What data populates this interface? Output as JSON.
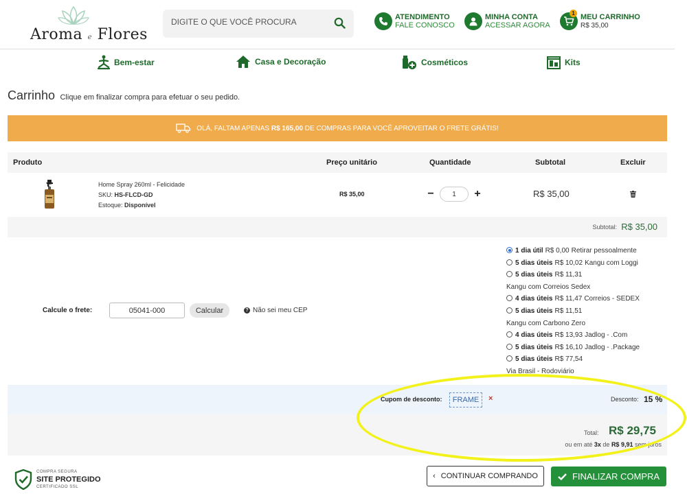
{
  "header": {
    "logo_text": "Aroma",
    "logo_amp": "e",
    "logo_text2": "Flores",
    "search_placeholder": "DIGITE O QUE VOCÊ PROCURA",
    "support_title": "ATENDIMENTO",
    "support_sub": "FALE CONOSCO",
    "account_title": "MINHA CONTA",
    "account_sub": "ACESSAR AGORA",
    "cart_title": "MEU CARRINHO",
    "cart_total": "R$ 35,00",
    "cart_count": "1"
  },
  "nav": [
    {
      "label": "Bem-estar",
      "icon": "yoga-icon"
    },
    {
      "label": "Casa e Decoração",
      "icon": "house-icon"
    },
    {
      "label": "Cosméticos",
      "icon": "cosmetics-icon"
    },
    {
      "label": "Kits",
      "icon": "kits-icon"
    }
  ],
  "page": {
    "title": "Carrinho",
    "subtitle": "Clique em finalizar compra para efetuar o seu pedido."
  },
  "banner": {
    "pre": "OLÁ, FALTAM APENAS",
    "amount": "R$ 165,00",
    "post": "DE COMPRAS PARA VOCÊ APROVEITAR O FRETE GRÁTIS!"
  },
  "table": {
    "headers": [
      "Produto",
      "Preço unitário",
      "Quantidade",
      "Subtotal",
      "Excluir"
    ],
    "item": {
      "name": "Home Spray 260ml - Felicidade",
      "sku_label": "SKU:",
      "sku": "HS-FLCD-GD",
      "stock_label": "Estoque:",
      "stock": "Disponível",
      "unit_price": "R$ 35,00",
      "quantity": "1",
      "subtotal": "R$ 35,00"
    },
    "subtotal_label": "Subtotal:",
    "subtotal_value": "R$ 35,00"
  },
  "shipping": {
    "label": "Calcule o frete:",
    "cep": "05041-000",
    "calc_button": "Calcular",
    "dont_know": "Não sei meu CEP",
    "options": [
      {
        "days": "1 dia útil",
        "price": "R$ 0,00",
        "carrier": "Retirar pessoalmente",
        "selected": true,
        "wrap": false
      },
      {
        "days": "5 dias úteis",
        "price": "R$ 10,02",
        "carrier": "Kangu com Loggi",
        "selected": false,
        "wrap": false
      },
      {
        "days": "5 dias úteis",
        "price": "R$ 11,31",
        "carrier": "Kangu com Correios Sedex",
        "selected": false,
        "wrap": true
      },
      {
        "days": "4 dias úteis",
        "price": "R$ 11,47",
        "carrier": "Correios - SEDEX",
        "selected": false,
        "wrap": false
      },
      {
        "days": "5 dias úteis",
        "price": "R$ 11,51",
        "carrier": "Kangu com Carbono Zero",
        "selected": false,
        "wrap": true
      },
      {
        "days": "4 dias úteis",
        "price": "R$ 13,93",
        "carrier": "Jadlog - .Com",
        "selected": false,
        "wrap": false
      },
      {
        "days": "5 dias úteis",
        "price": "R$ 16,10",
        "carrier": "Jadlog - .Package",
        "selected": false,
        "wrap": false
      },
      {
        "days": "5 dias úteis",
        "price": "R$ 77,54",
        "carrier": "Via Brasil - Rodoviário",
        "selected": false,
        "wrap": true
      }
    ]
  },
  "coupon": {
    "label": "Cupom de desconto:",
    "code": "FRAME",
    "remove": "×",
    "discount_label": "Desconto:",
    "discount_value": "15 %"
  },
  "total": {
    "label": "Total:",
    "value": "R$ 29,75",
    "inst_pre": "ou em até",
    "inst_times": "3x",
    "inst_mid": "de",
    "inst_value": "R$ 9,91",
    "inst_post": "sem juros"
  },
  "footer": {
    "secure_top": "COMPRA SEGURA",
    "secure_main": "SITE PROTEGIDO",
    "secure_bottom": "CERTIFICADO SSL",
    "continue_button": "CONTINUAR COMPRANDO",
    "finalize_button": "FINALIZAR COMPRA"
  },
  "colors": {
    "brand_green": "#1e7a2e",
    "banner_orange": "#f0ab4d",
    "finalize_green": "#24913a",
    "annotation_yellow": "#f2f21a"
  }
}
